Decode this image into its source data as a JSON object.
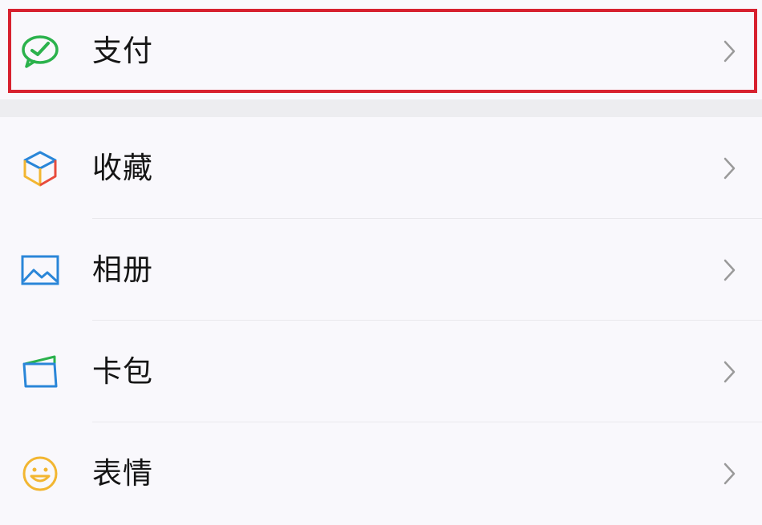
{
  "menu": {
    "pay": {
      "label": "支付",
      "icon": "wechat-pay-icon",
      "color": "#2bb24c"
    },
    "favorites": {
      "label": "收藏",
      "icon": "favorites-cube-icon"
    },
    "album": {
      "label": "相册",
      "icon": "album-picture-icon",
      "color": "#2a86d8"
    },
    "cards": {
      "label": "卡包",
      "icon": "card-wallet-icon",
      "color": "#2a86d8"
    },
    "stickers": {
      "label": "表情",
      "icon": "smiley-face-icon",
      "color": "#f2b631"
    }
  },
  "highlight": {
    "target": "pay",
    "color": "#d7212f"
  },
  "chevron": {
    "icon": "chevron-right-icon",
    "color": "#9a9a9a"
  }
}
